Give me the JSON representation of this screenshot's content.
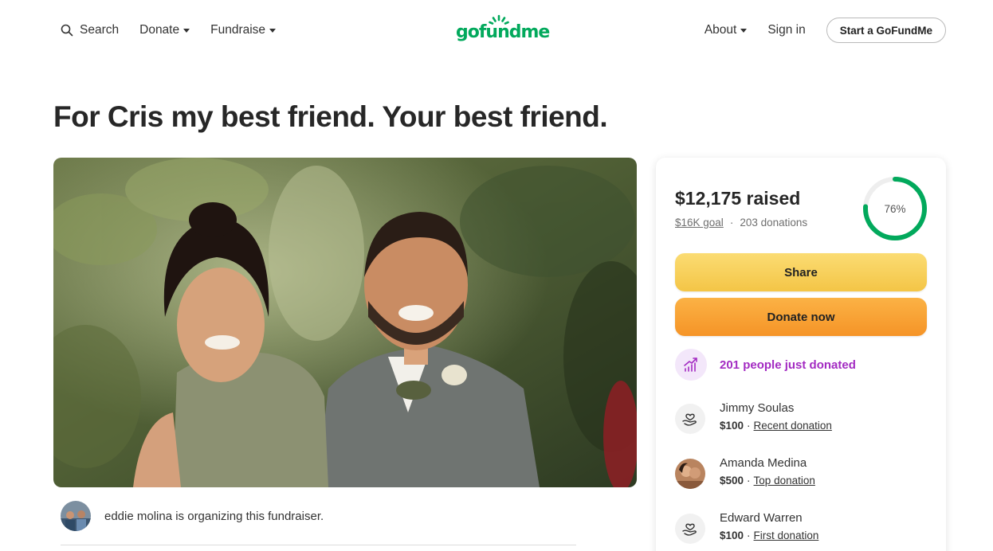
{
  "header": {
    "search_label": "Search",
    "donate_label": "Donate",
    "fundraise_label": "Fundraise",
    "logo_text": "gofundme",
    "about_label": "About",
    "signin_label": "Sign in",
    "start_label": "Start a GoFundMe"
  },
  "campaign": {
    "title": "For Cris my best friend. Your best friend.",
    "organizer_text": "eddie molina is organizing this fundraiser."
  },
  "progress": {
    "raised": "$12,175 raised",
    "goal": "$16K goal",
    "separator": "·",
    "donations": "203 donations",
    "percent_label": "76%",
    "percent_value": 0.76
  },
  "actions": {
    "share_label": "Share",
    "donate_label": "Donate now"
  },
  "activity": {
    "trend_text": "201 people just donated"
  },
  "donors": [
    {
      "name": "Jimmy Soulas",
      "amount": "$100",
      "sep": "·",
      "tag": "Recent donation"
    },
    {
      "name": "Amanda Medina",
      "amount": "$500",
      "sep": "·",
      "tag": "Top donation"
    },
    {
      "name": "Edward Warren",
      "amount": "$100",
      "sep": "·",
      "tag": "First donation"
    }
  ],
  "colors": {
    "brand": "#02a95c",
    "share": "#f4c546",
    "donate": "#f59427",
    "trend": "#a32bc2"
  }
}
